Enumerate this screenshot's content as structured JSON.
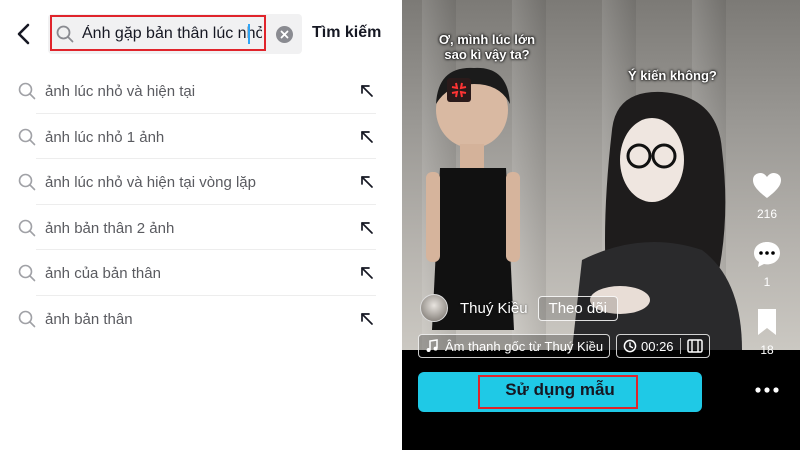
{
  "search": {
    "query": "Ảnh gặp bản thân lúc nhỏ",
    "submit_label": "Tìm kiếm"
  },
  "suggestions": [
    {
      "text": "ảnh lúc nhỏ và hiện tại"
    },
    {
      "text": "ảnh lúc nhỏ 1 ảnh"
    },
    {
      "text": "ảnh lúc nhỏ và hiện tại vòng lặp"
    },
    {
      "text": "ảnh bản thân 2 ảnh"
    },
    {
      "text": "ảnh của bản thân"
    },
    {
      "text": "ảnh bản thân"
    }
  ],
  "video": {
    "bubble_left": "Ơ, mình lúc lớn sao kì vậy ta?",
    "bubble_right": "Ý kiến không?",
    "creator": "Thuý Kiều",
    "follow_label": "Theo dõi",
    "music": "Âm thanh gốc từ Thuý Kiều",
    "duration": "00:26",
    "likes": "216",
    "comments": "1",
    "saves": "18",
    "use_template_label": "Sử dụng mẫu"
  },
  "colors": {
    "accent_button": "#1fc9e6",
    "highlight_box": "#e0242b",
    "caret": "#2fa5f5"
  }
}
